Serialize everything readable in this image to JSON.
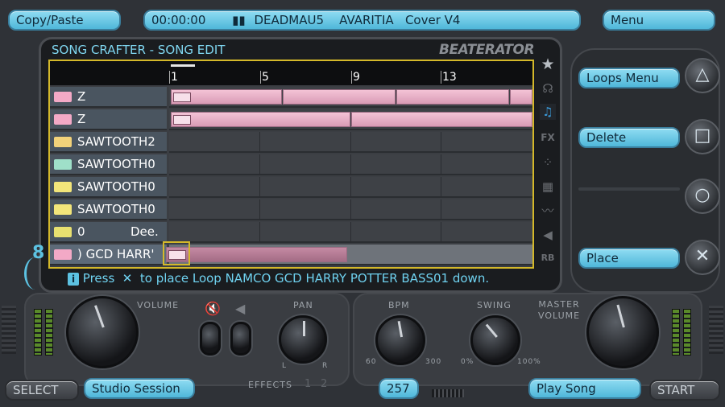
{
  "top": {
    "copy_paste": "Copy/Paste",
    "time": "00:00:00",
    "song_title": "DEADMAU5    AVARITIA   Cover V4",
    "menu": "Menu"
  },
  "screen": {
    "header": "SONG CRAFTER - SONG EDIT",
    "logo": "BEATERATOR",
    "bar_markers": [
      "1",
      "5",
      "9",
      "13"
    ],
    "tracks": [
      {
        "name": "Z",
        "extra": "",
        "icon_color": "#f3a9c6"
      },
      {
        "name": "Z",
        "extra": "",
        "icon_color": "#f3a9c6"
      },
      {
        "name": "SAWTOOTH2",
        "extra": "",
        "icon_color": "#f2d27a"
      },
      {
        "name": "SAWTOOTH0",
        "extra": "",
        "icon_color": "#9fe0c9"
      },
      {
        "name": "SAWTOOTH0",
        "extra": "",
        "icon_color": "#f2e57a"
      },
      {
        "name": "SAWTOOTH0",
        "extra": "",
        "icon_color": "#f2e57a"
      },
      {
        "name": "0",
        "extra": "Dee.",
        "icon_color": "#e8e070"
      },
      {
        "name": ") GCD HARR'",
        "extra": "",
        "icon_color": "#f3a9c6"
      }
    ],
    "level_number": "8",
    "help_text": "Press  ✕  to place Loop NAMCO GCD HARRY POTTER BASS01 down."
  },
  "side_menu": {
    "loops_menu": "Loops Menu",
    "delete": "Delete",
    "empty": "",
    "place": "Place",
    "triangle_glyph": "△",
    "square_glyph": "□",
    "circle_glyph": "○",
    "cross_glyph": "✕"
  },
  "controls": {
    "volume": "VOLUME",
    "pan": "PAN",
    "pan_l": "L",
    "pan_r": "R",
    "effects": "EFFECTS",
    "effects_1": "1",
    "effects_2": "2",
    "bpm": "BPM",
    "bpm_min": "60",
    "bpm_max": "300",
    "swing": "SWING",
    "swing_min": "0%",
    "swing_max": "100%",
    "master_volume_1": "MASTER",
    "master_volume_2": "VOLUME"
  },
  "bottom": {
    "select": "SELECT",
    "studio_session": "Studio Session",
    "bpm_value": "257",
    "play_song": "Play Song",
    "start": "START"
  },
  "colors": {
    "accent": "#5cc2e2",
    "clip": "#e9afc7",
    "grid_border": "#d4b82a"
  }
}
